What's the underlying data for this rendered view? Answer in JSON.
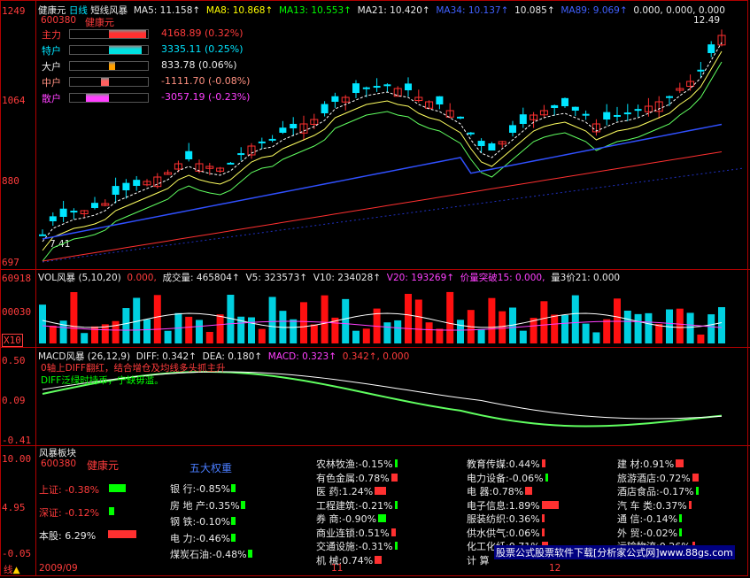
{
  "header": {
    "stock_name": "健康元",
    "period": "日线",
    "style": "短线风暴",
    "ma5": "MA5: 11.158↑",
    "ma8": "MA8: 10.868↑",
    "ma13": "MA13: 10.553↑",
    "ma21": "MA21: 10.420↑",
    "ma34": "MA34: 10.137↑",
    "ma55": "10.085↑",
    "ma89": "MA89: 9.069↑",
    "extra": "0.000, 0.000, 0.000"
  },
  "stock_code": "600380",
  "stock_label": "健康元",
  "high_mark": "12.49",
  "low_mark": "7.41",
  "price_axis": [
    "1249",
    "1064",
    "880",
    "697"
  ],
  "fund_flows": [
    {
      "label": "主力",
      "value": "4168.89 (0.32%)",
      "fill": 0.95,
      "color": "#ff3030"
    },
    {
      "label": "特户",
      "value": "3335.11 (0.25%)",
      "fill": 0.85,
      "color": "#00e0e0"
    },
    {
      "label": "大户",
      "value": "833.78 (0.06%)",
      "fill": 0.15,
      "color": "#ffa000"
    },
    {
      "label": "中户",
      "value": "-1111.70 (-0.08%)",
      "fill": 0.2,
      "color": "#ff6060"
    },
    {
      "label": "散户",
      "value": "-3057.19 (-0.23%)",
      "fill": 0.6,
      "color": "#ff40ff"
    }
  ],
  "vol": {
    "title": "VOL风暴 (5,10,20)",
    "v0": "0.000,",
    "cjl": "成交量: 465804↑",
    "v5": "V5: 323573↑",
    "v10": "V10: 234028↑",
    "v20": "V20: 193269↑",
    "breakout": "价量突破15: 0.000,",
    "lj": "量3价21: 0.000",
    "axis_top": "60918",
    "axis_mid": "00030",
    "axis_unit": "X10"
  },
  "macd": {
    "title": "MACD风暴 (26,12,9)",
    "diff": "DIFF: 0.342↑",
    "dea": "DEA: 0.180↑",
    "macd": "MACD: 0.323↑",
    "extra": "0.342↑,  0.000",
    "note1": "0轴上DIFF翻红，结合增仓及均线多头抓主升",
    "note2": "DIFF泛绿时持币，宁缺毋滥。",
    "axis": [
      "0.50",
      "0.09",
      "-0.41"
    ]
  },
  "bottom": {
    "title": "风暴板块",
    "code": "600380",
    "name": "健康元",
    "weights_title": "五大权重",
    "axis": [
      "10.00",
      "4.95",
      "-0.05"
    ],
    "indices": [
      {
        "label": "上证:",
        "value": "-0.38%",
        "color": "#00ff00"
      },
      {
        "label": "深证:",
        "value": "-0.12%",
        "color": "#00ff00"
      },
      {
        "label": "本股:",
        "value": "6.29%",
        "color": "#ff3030"
      }
    ],
    "weights": [
      {
        "name": "银  行:",
        "value": "-0.85%"
      },
      {
        "name": "房 地 产:",
        "value": "0.35%"
      },
      {
        "name": "钢  铁:",
        "value": "-0.10%"
      },
      {
        "name": "电  力:",
        "value": "-0.46%"
      },
      {
        "name": "煤炭石油:",
        "value": "-0.48%"
      }
    ],
    "col1": [
      {
        "name": "农林牧渔:",
        "value": "-0.15%"
      },
      {
        "name": "有色金属:",
        "value": "0.78%"
      },
      {
        "name": "医  药:",
        "value": "1.24%"
      },
      {
        "name": "工程建筑:",
        "value": "-0.21%"
      },
      {
        "name": "券  商:",
        "value": "-0.90%"
      },
      {
        "name": "商业连锁:",
        "value": "0.51%"
      },
      {
        "name": "交通设施:",
        "value": "-0.31%"
      },
      {
        "name": "机  械:",
        "value": "0.74%"
      }
    ],
    "col2": [
      {
        "name": "教育传媒:",
        "value": "0.44%"
      },
      {
        "name": "电力设备:",
        "value": "-0.06%"
      },
      {
        "name": "电  器:",
        "value": "0.78%"
      },
      {
        "name": "电子信息:",
        "value": "1.89%"
      },
      {
        "name": "服装纺织:",
        "value": "0.36%"
      },
      {
        "name": "供水供气:",
        "value": "0.06%"
      },
      {
        "name": "化工化纤:",
        "value": "0.71%"
      },
      {
        "name": "计  算",
        "value": ""
      }
    ],
    "col3": [
      {
        "name": "建  材:",
        "value": "0.91%"
      },
      {
        "name": "旅游酒店:",
        "value": "0.72%"
      },
      {
        "name": "酒店食品:",
        "value": "-0.17%"
      },
      {
        "name": "汽 车 类:",
        "value": "0.37%"
      },
      {
        "name": "通  信:",
        "value": "-0.14%"
      },
      {
        "name": "外  贸:",
        "value": "-0.02%"
      },
      {
        "name": "运输物流:",
        "value": "0.26%"
      }
    ]
  },
  "xaxis": {
    "start": "2009/09",
    "m11": "11",
    "m12": "12",
    "left": "线"
  },
  "footer": "股票公式股票软件下载[分析家公式网]www.88gs.com"
}
